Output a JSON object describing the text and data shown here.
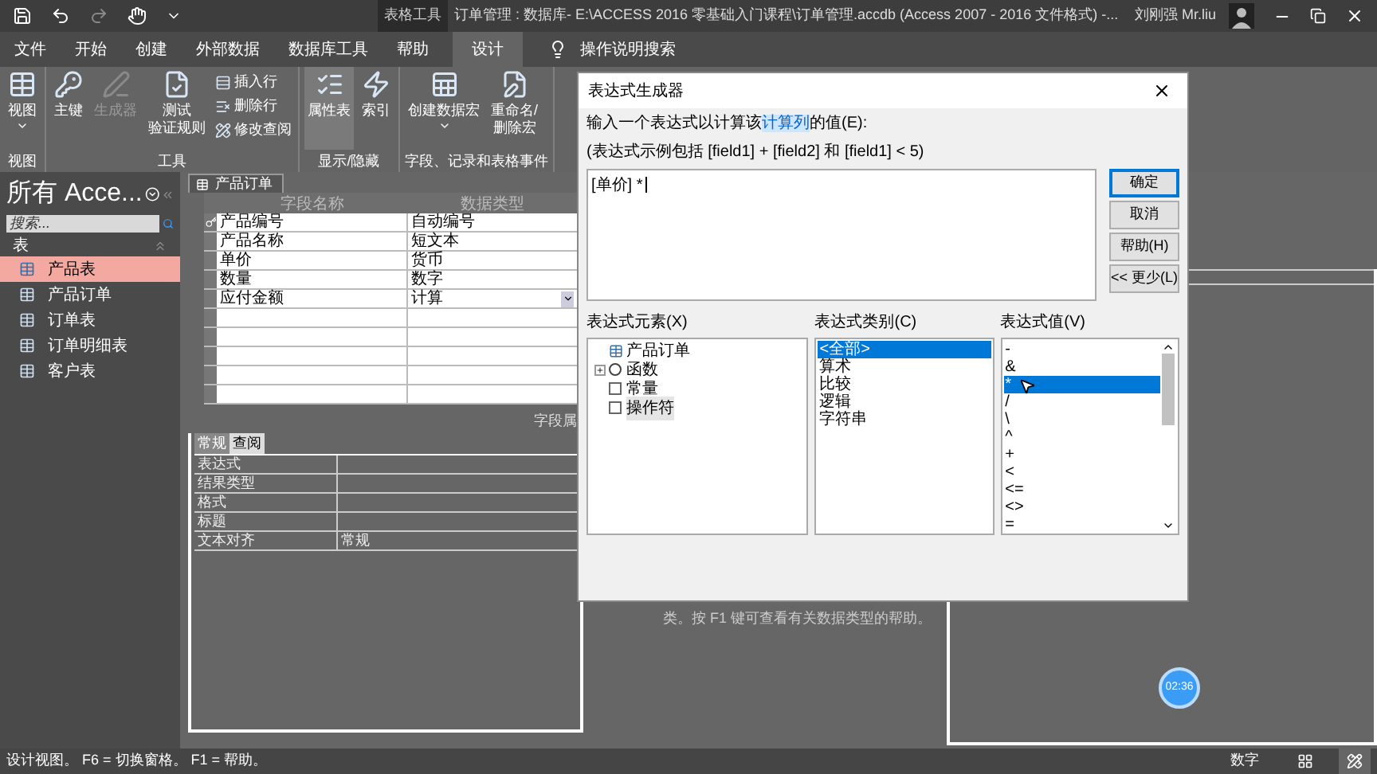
{
  "title_bar": {
    "context_tab": "表格工具",
    "title": "订单管理 : 数据库- E:\\ACCESS 2016 零基础入门课程\\订单管理.accdb (Access 2007 - 2016 文件格式) -...",
    "user": "刘刚强 Mr.liu"
  },
  "menu_tabs": [
    {
      "label": "文件",
      "selected": false
    },
    {
      "label": "开始",
      "selected": false
    },
    {
      "label": "创建",
      "selected": false
    },
    {
      "label": "外部数据",
      "selected": false
    },
    {
      "label": "数据库工具",
      "selected": false
    },
    {
      "label": "帮助",
      "selected": false
    },
    {
      "label": "设计",
      "selected": true
    }
  ],
  "tell_me": "操作说明搜索",
  "ribbon_groups": [
    {
      "label": "视图",
      "items": [
        {
          "kind": "large",
          "label": "视图",
          "dropdown": true,
          "disabled": false,
          "pressed": false
        }
      ]
    },
    {
      "label": "工具",
      "items": [
        {
          "kind": "large",
          "label": "主键",
          "dropdown": false,
          "disabled": false,
          "pressed": false
        },
        {
          "kind": "large",
          "label": "生成器",
          "dropdown": false,
          "disabled": true,
          "pressed": false
        },
        {
          "kind": "large",
          "lines": [
            "测试",
            "验证规则"
          ],
          "dropdown": false,
          "disabled": false,
          "pressed": false
        },
        {
          "kind": "small",
          "label": "插入行",
          "dropdown": false,
          "disabled": false,
          "pressed": false
        },
        {
          "kind": "small",
          "label": "删除行",
          "dropdown": false,
          "disabled": false,
          "pressed": false
        },
        {
          "kind": "small",
          "label": "修改查阅",
          "dropdown": false,
          "disabled": false,
          "pressed": false
        }
      ]
    },
    {
      "label": "显示/隐藏",
      "items": [
        {
          "kind": "large",
          "label": "属性表",
          "dropdown": false,
          "disabled": false,
          "pressed": true
        },
        {
          "kind": "large",
          "label": "索引",
          "dropdown": false,
          "disabled": false,
          "pressed": false
        }
      ]
    },
    {
      "label": "字段、记录和表格事件",
      "items": [
        {
          "kind": "large",
          "label": "创建数据宏",
          "dropdown": true,
          "disabled": false,
          "pressed": false
        },
        {
          "kind": "large",
          "lines": [
            "重命名/",
            "删除宏"
          ],
          "dropdown": false,
          "disabled": false,
          "pressed": false
        }
      ]
    }
  ],
  "nav": {
    "title": "所有 Acce...",
    "search": {
      "placeholder": "搜索..."
    },
    "section": "表",
    "items": [
      {
        "label": "产品表",
        "selected": true
      },
      {
        "label": "产品订单",
        "selected": false
      },
      {
        "label": "订单表",
        "selected": false
      },
      {
        "label": "订单明细表",
        "selected": false
      },
      {
        "label": "客户表",
        "selected": false
      }
    ]
  },
  "document": {
    "tab": "产品订单",
    "columns": [
      "字段名称",
      "数据类型"
    ],
    "rows": [
      {
        "field": "产品编号",
        "type": "自动编号",
        "primary_key": true,
        "current": false
      },
      {
        "field": "产品名称",
        "type": "短文本",
        "primary_key": false,
        "current": false
      },
      {
        "field": "单价",
        "type": "货币",
        "primary_key": false,
        "current": false
      },
      {
        "field": "数量",
        "type": "数字",
        "primary_key": false,
        "current": false
      },
      {
        "field": "应付金额",
        "type": "计算",
        "primary_key": false,
        "current": true
      }
    ]
  },
  "field_properties": {
    "label": "字段属",
    "tabs": [
      {
        "label": "常规",
        "selected": true
      },
      {
        "label": "查阅",
        "selected": false
      }
    ],
    "rows": [
      {
        "name": "表达式"
      },
      {
        "name": "结果类型"
      },
      {
        "name": "格式"
      },
      {
        "name": "标题"
      },
      {
        "name": "文本对齐",
        "value": "常规"
      }
    ]
  },
  "help_text": "类。按 F1 键可查看有关数据类型的帮助。",
  "dialog": {
    "title": "表达式生成器",
    "instruction": "输入一个表达式以计算该",
    "instruction_link": "计算列",
    "instruction_end": "的值(E):",
    "example": "(表达式示例包括 [field1] + [field2] 和 [field1] < 5)",
    "expression": "[单价] *",
    "buttons": [
      {
        "label": "确定",
        "default": true
      },
      {
        "label": "取消",
        "default": false
      },
      {
        "label": "帮助(H)",
        "default": false
      },
      {
        "label": "<< 更少(L)",
        "default": false
      }
    ],
    "elements": {
      "label": "表达式元素(X)",
      "items": [
        {
          "kind": "table",
          "label": "产品订单",
          "selected": false
        },
        {
          "kind": "group",
          "label": "函数",
          "selected": false,
          "expanded": false
        },
        {
          "kind": "item",
          "label": "常量",
          "selected": false
        },
        {
          "kind": "item",
          "label": "操作符",
          "selected": true
        }
      ]
    },
    "categories": {
      "label": "表达式类别(C)",
      "items": [
        {
          "label": "<全部>",
          "selected": true
        },
        {
          "label": "算术",
          "selected": false
        },
        {
          "label": "比较",
          "selected": false
        },
        {
          "label": "逻辑",
          "selected": false
        },
        {
          "label": "字符串",
          "selected": false
        }
      ]
    },
    "values": {
      "label": "表达式值(V)",
      "items": [
        {
          "label": "-",
          "selected": false
        },
        {
          "label": "&",
          "selected": false
        },
        {
          "label": "*",
          "selected": true
        },
        {
          "label": "/",
          "selected": false
        },
        {
          "label": "\\",
          "selected": false
        },
        {
          "label": "^",
          "selected": false
        },
        {
          "label": "+",
          "selected": false
        },
        {
          "label": "<",
          "selected": false
        },
        {
          "label": "<=",
          "selected": false
        },
        {
          "label": "<>",
          "selected": false
        },
        {
          "label": "=",
          "selected": false
        }
      ]
    }
  },
  "status_bar": {
    "text": "设计视图。 F6 = 切换窗格。 F1 = 帮助。",
    "mode": "数字"
  },
  "timer": "02:36"
}
